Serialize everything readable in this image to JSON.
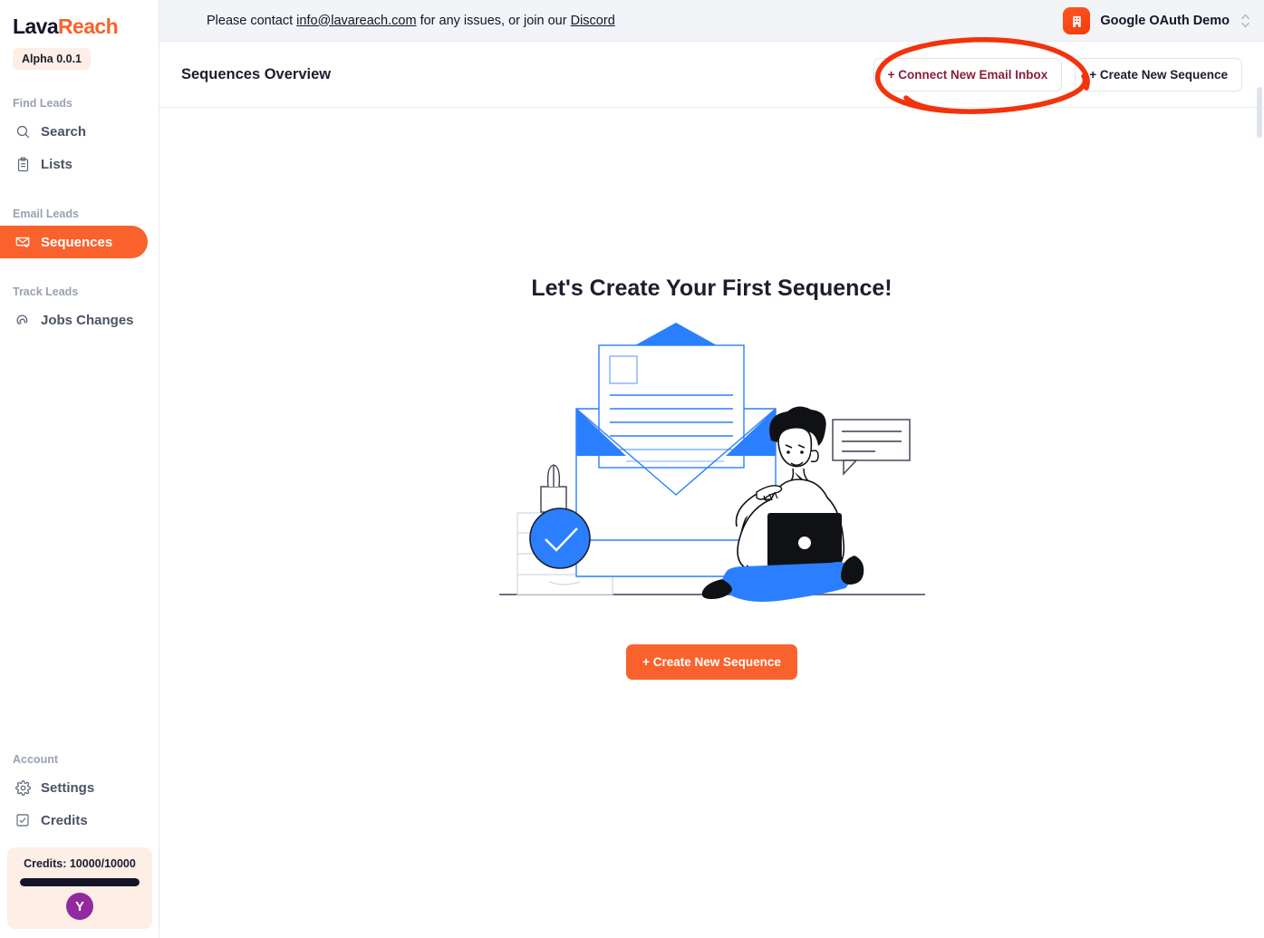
{
  "brand": {
    "logo_first": "Lava",
    "logo_second": "Reach",
    "version_badge": "Alpha 0.0.1",
    "accent_color": "#f9622c",
    "logo_dark_color": "#141527"
  },
  "banner": {
    "prefix": "Please contact ",
    "email": "info@lavareach.com",
    "middle": " for any issues, or join our ",
    "discord": "Discord"
  },
  "org": {
    "name": "Google OAuth Demo",
    "icon": "building-icon",
    "switcher_icon": "chevron-up-down-icon"
  },
  "sidebar": {
    "groups": [
      {
        "label": "Find Leads",
        "items": [
          {
            "label": "Search",
            "icon": "search-icon",
            "active": false
          },
          {
            "label": "Lists",
            "icon": "clipboard-icon",
            "active": false
          }
        ]
      },
      {
        "label": "Email Leads",
        "items": [
          {
            "label": "Sequences",
            "icon": "mail-heart-icon",
            "active": true
          }
        ]
      },
      {
        "label": "Track Leads",
        "items": [
          {
            "label": "Jobs Changes",
            "icon": "radar-icon",
            "active": false
          }
        ]
      }
    ],
    "account": {
      "label": "Account",
      "items": [
        {
          "label": "Settings",
          "icon": "gear-icon"
        },
        {
          "label": "Credits",
          "icon": "checkbox-icon"
        }
      ],
      "credits_text": "Credits: 10000/10000",
      "credits_used": 10000,
      "credits_total": 10000,
      "credits_percent": 100,
      "avatar_initial": "Y",
      "avatar_color": "#92299e"
    }
  },
  "header": {
    "title": "Sequences Overview",
    "connect_inbox_label": "+ Connect New Email Inbox",
    "create_sequence_label": "+ Create New Sequence"
  },
  "main": {
    "empty_title": "Let's Create Your First Sequence!",
    "cta_label": "+ Create New Sequence",
    "illustration": "email-person-laptop-illustration"
  },
  "annotation": {
    "type": "hand-drawn-ellipse",
    "color": "#f2330c",
    "target": "+ Connect New Email Inbox"
  }
}
